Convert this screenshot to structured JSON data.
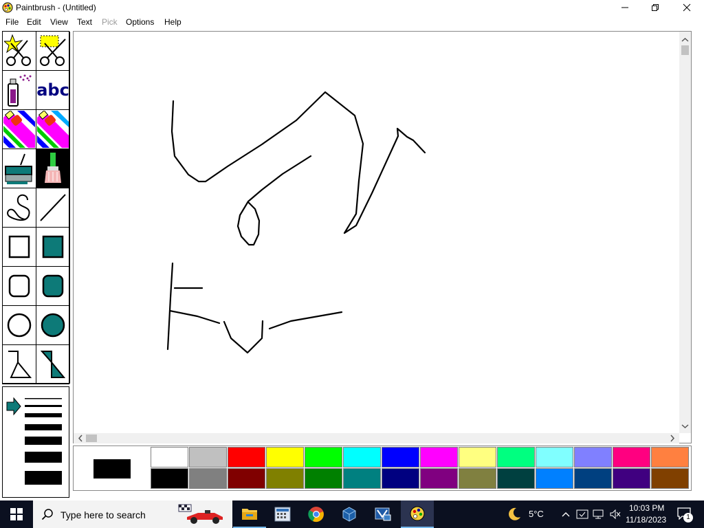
{
  "window": {
    "title": "Paintbrush - (Untitled)"
  },
  "menu": [
    "File",
    "Edit",
    "View",
    "Text",
    "Pick",
    "Options",
    "Help"
  ],
  "menu_disabled": [
    "Pick"
  ],
  "tools": [
    {
      "name": "scissors-icon"
    },
    {
      "name": "pick-scissors-icon"
    },
    {
      "name": "airbrush-icon"
    },
    {
      "name": "text-tool-icon",
      "text": "abc"
    },
    {
      "name": "color-eraser-icon"
    },
    {
      "name": "eraser-icon"
    },
    {
      "name": "paint-roller-icon"
    },
    {
      "name": "brush-icon"
    },
    {
      "name": "curve-icon"
    },
    {
      "name": "line-icon"
    },
    {
      "name": "box-icon"
    },
    {
      "name": "filled-box-icon"
    },
    {
      "name": "rounded-box-icon"
    },
    {
      "name": "filled-rounded-box-icon"
    },
    {
      "name": "circle-icon"
    },
    {
      "name": "filled-circle-icon"
    },
    {
      "name": "polygon-icon"
    },
    {
      "name": "filled-polygon-icon"
    }
  ],
  "selected_tool": "brush-icon",
  "accent_teal": "#0d7a78",
  "palette": {
    "foreground": "#000000",
    "background": "#ffffff",
    "top_row": [
      "#ffffff",
      "#c0c0c0",
      "#ff0000",
      "#ffff00",
      "#00ff00",
      "#00ffff",
      "#0000ff",
      "#ff00ff",
      "#ffff80",
      "#00ff80",
      "#80ffff",
      "#8080ff",
      "#ff0080",
      "#ff8040"
    ],
    "bottom_row": [
      "#000000",
      "#808080",
      "#800000",
      "#808000",
      "#008000",
      "#008080",
      "#000080",
      "#800080",
      "#808040",
      "#004040",
      "#0080ff",
      "#004080",
      "#400080",
      "#804000"
    ]
  },
  "taskbar": {
    "search_placeholder": "Type here to search",
    "weather": "5°C",
    "time": "10:03 PM",
    "date": "11/18/2023",
    "notification_count": "1",
    "apps": [
      "file-explorer-icon",
      "calculator-icon",
      "chrome-icon",
      "virtualbox-icon",
      "vmware-icon",
      "paintbrush-icon"
    ]
  }
}
